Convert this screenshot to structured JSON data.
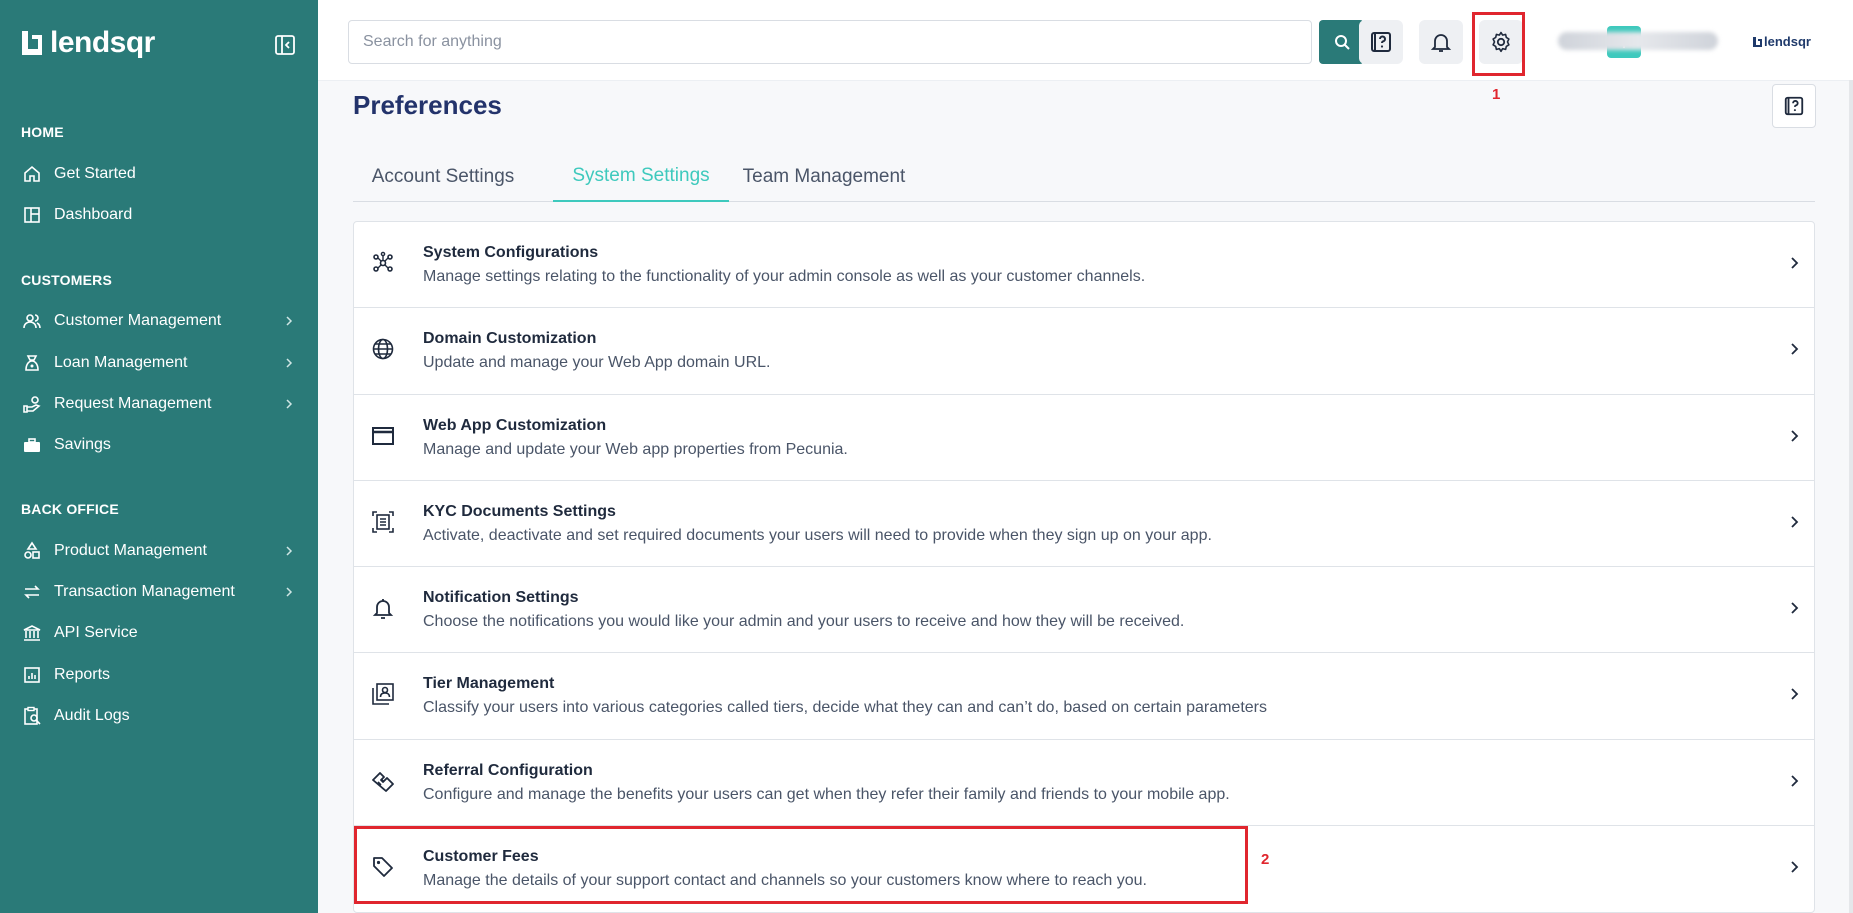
{
  "sidebar": {
    "brand": "lendsqr",
    "sections": [
      {
        "title": "HOME"
      },
      {
        "title": "CUSTOMERS"
      },
      {
        "title": "BACK OFFICE"
      }
    ],
    "items": [
      {
        "label": "Get Started",
        "icon": "home-icon"
      },
      {
        "label": "Dashboard",
        "icon": "dashboard-icon"
      },
      {
        "label": "Customer Management",
        "icon": "users-icon"
      },
      {
        "label": "Loan Management",
        "icon": "loan-icon"
      },
      {
        "label": "Request Management",
        "icon": "request-icon"
      },
      {
        "label": "Savings",
        "icon": "savings-icon"
      },
      {
        "label": "Product Management",
        "icon": "product-icon"
      },
      {
        "label": "Transaction Management",
        "icon": "transaction-icon"
      },
      {
        "label": "API Service",
        "icon": "bank-icon"
      },
      {
        "label": "Reports",
        "icon": "reports-icon"
      },
      {
        "label": "Audit Logs",
        "icon": "audit-icon"
      }
    ]
  },
  "topbar": {
    "search_placeholder": "Search for anything",
    "brand_small": "lendsqr",
    "annotation_1": "1",
    "annotation_2": "2"
  },
  "page": {
    "title": "Preferences",
    "tabs": [
      {
        "label": "Account Settings",
        "active": false
      },
      {
        "label": "System Settings",
        "active": true
      },
      {
        "label": "Team Management",
        "active": false
      }
    ],
    "settings": [
      {
        "title": "System Configurations",
        "desc": "Manage settings relating to the functionality of your admin console as well as your customer channels.",
        "icon": "network-icon"
      },
      {
        "title": "Domain Customization",
        "desc": "Update and manage your Web App domain URL.",
        "icon": "globe-icon"
      },
      {
        "title": "Web App Customization",
        "desc": "Manage and update your Web app properties from Pecunia.",
        "icon": "window-icon"
      },
      {
        "title": "KYC Documents Settings",
        "desc": "Activate, deactivate and set required documents your users will need to provide when they sign up on your app.",
        "icon": "document-scan-icon"
      },
      {
        "title": "Notification Settings",
        "desc": "Choose the notifications you would like your admin and your users to receive and how they will be received.",
        "icon": "bell-icon"
      },
      {
        "title": "Tier Management",
        "desc": "Classify your users into various categories called tiers, decide what they can and can’t do, based on certain parameters",
        "icon": "tier-icon"
      },
      {
        "title": "Referral Configuration",
        "desc": "Configure and manage the benefits your users can get when they refer their family and friends to your mobile app.",
        "icon": "handshake-icon"
      },
      {
        "title": "Customer Fees",
        "desc": "Manage the details of your support contact and channels so your customers know where to reach you.",
        "icon": "tag-icon"
      }
    ]
  },
  "colors": {
    "sidebar_bg": "#2a7a78",
    "accent": "#3ec9bd",
    "highlight": "#e0262e",
    "title": "#23336b"
  }
}
